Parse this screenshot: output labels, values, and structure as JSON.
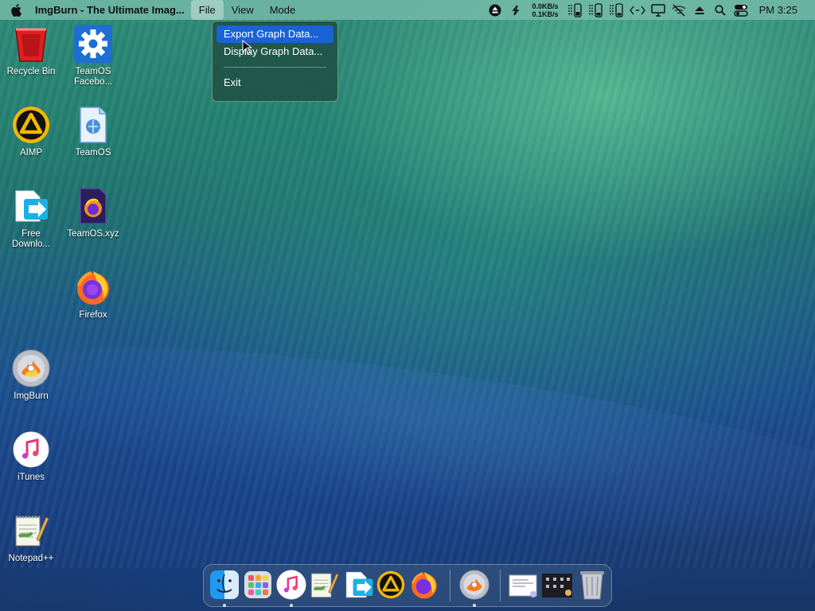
{
  "menubar": {
    "app_title": "ImgBurn - The Ultimate Imag...",
    "menus": [
      "File",
      "View",
      "Mode"
    ],
    "netspeed_up": "0.0KB/s",
    "netspeed_down": "0.1KB/s",
    "clock": "PM 3:25"
  },
  "file_menu": {
    "items": [
      "Export Graph Data...",
      "Display Graph Data...",
      "Exit"
    ]
  },
  "desktop_icons": [
    {
      "label": "Recycle Bin"
    },
    {
      "label": "TeamOS Facebo..."
    },
    {
      "label": "AIMP"
    },
    {
      "label": "TeamOS"
    },
    {
      "label": "Free Downlo..."
    },
    {
      "label": "TeamOS.xyz"
    },
    {
      "label": "Firefox"
    },
    {
      "label": "ImgBurn"
    },
    {
      "label": "iTunes"
    },
    {
      "label": "Notepad++"
    }
  ],
  "colors": {
    "menu_highlight": "#1a62d6",
    "recycle_red": "#e02020",
    "gear_blue": "#1e6fd0",
    "aimp_yellow": "#f2b705"
  }
}
